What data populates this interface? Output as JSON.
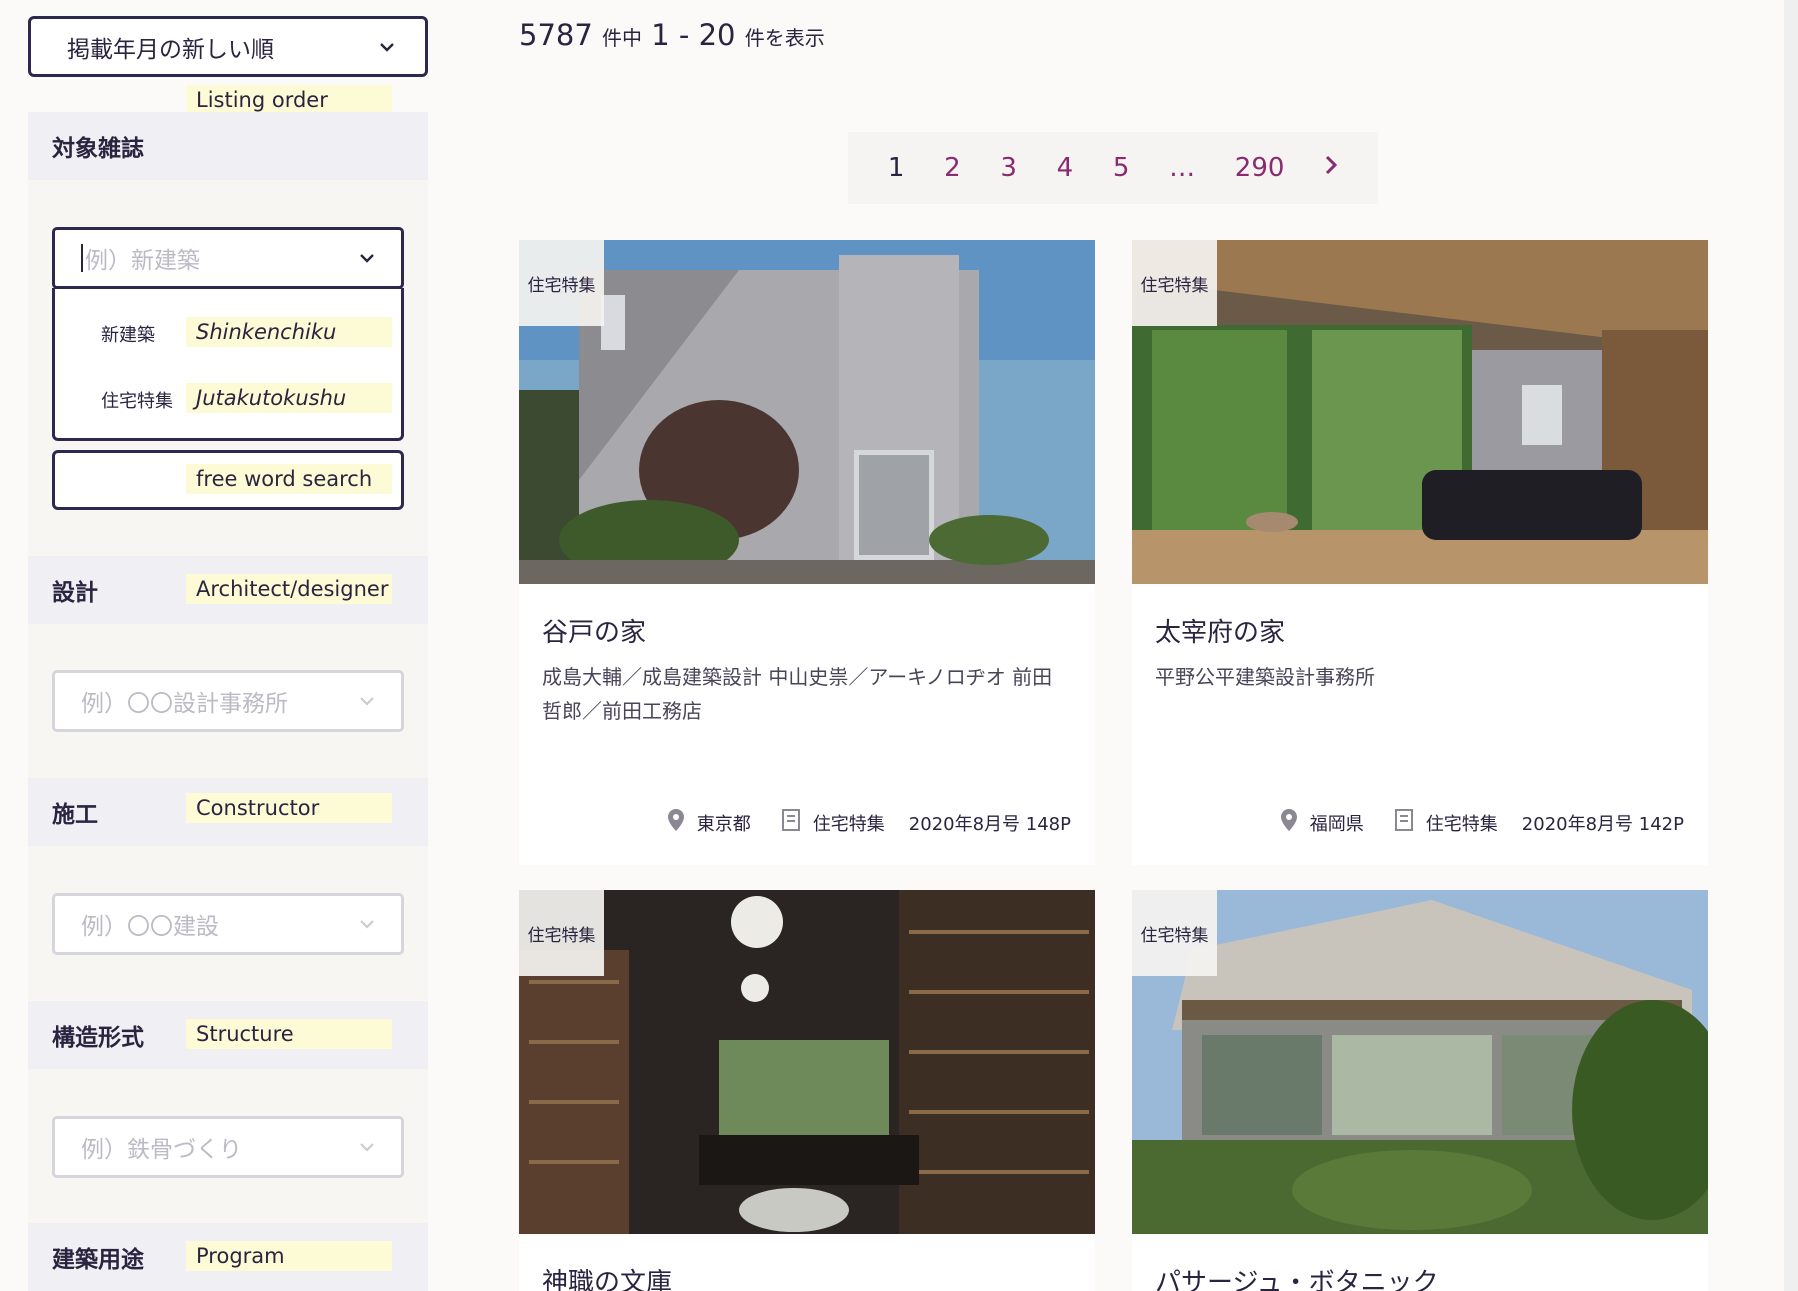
{
  "sidebar": {
    "sort": {
      "value": "掲載年月の新しい順",
      "note": "Listing order"
    },
    "magazine": {
      "heading": "対象雑誌",
      "placeholder": "例）新建築",
      "options": [
        {
          "label": "新建築",
          "note": "Shinkenchiku"
        },
        {
          "label": "住宅特集",
          "note": "Jutakutokushu"
        }
      ]
    },
    "freeword_note": "free word search",
    "designer": {
      "heading": "設計",
      "note": "Architect/designer",
      "placeholder": "例）〇〇設計事務所"
    },
    "constructor": {
      "heading": "施工",
      "note": "Constructor",
      "placeholder": "例）〇〇建設"
    },
    "structure": {
      "heading": "構造形式",
      "note": "Structure",
      "placeholder": "例）鉄骨づくり"
    },
    "program": {
      "heading": "建築用途",
      "note": "Program"
    }
  },
  "results": {
    "total": "5787",
    "total_suffix": "件中",
    "range": "1 - 20",
    "range_suffix": "件を表示"
  },
  "pagination": {
    "pages": [
      "1",
      "2",
      "3",
      "4",
      "5",
      "…",
      "290"
    ],
    "current": "1",
    "next_icon": "chevron-right-icon"
  },
  "cards": [
    {
      "tag": "住宅特集",
      "title": "谷戸の家",
      "designers": "成島大輔／成島建築設計 中山史祟／アーキノロヂオ 前田哲郎／前田工務店",
      "location": "東京都",
      "magazine": "住宅特集",
      "issue": "2020年8月号 148P"
    },
    {
      "tag": "住宅特集",
      "title": "太宰府の家",
      "designers": "平野公平建築設計事務所",
      "location": "福岡県",
      "magazine": "住宅特集",
      "issue": "2020年8月号 142P"
    },
    {
      "tag": "住宅特集",
      "title": "神職の文庫"
    },
    {
      "tag": "住宅特集",
      "title": "パサージュ・ボタニック"
    }
  ],
  "colors": {
    "navy": "#2e2750",
    "page_link": "#8a2a6f",
    "note_bg": "#fdfbd6"
  }
}
